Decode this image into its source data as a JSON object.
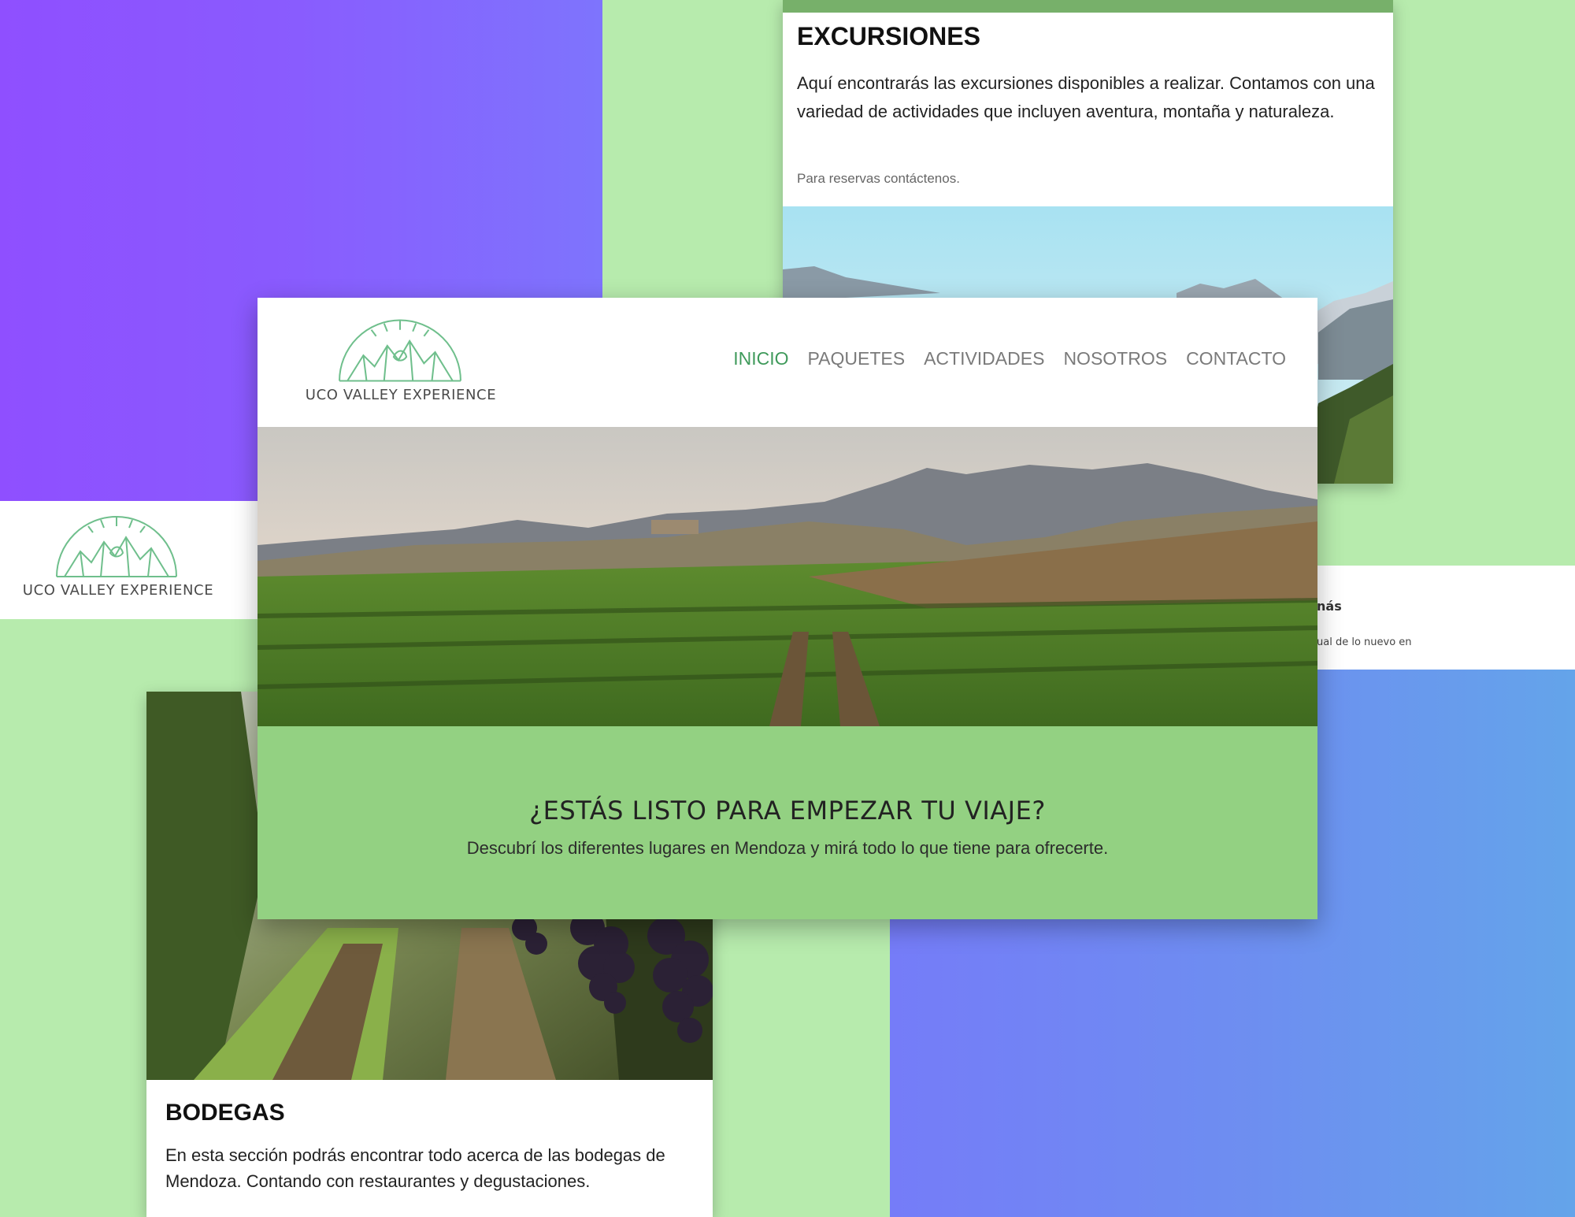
{
  "brand": {
    "name": "UCO VALLEY EXPERIENCE",
    "logo_icon": "mountain-arch-logo-icon",
    "logo_color": "#6fbf8c"
  },
  "side_logo": {
    "name": "UCO VALLEY EXPERIENCE"
  },
  "right_strip": {
    "title_fragment": "nás",
    "text_fragment": "ual de lo nuevo en"
  },
  "excursiones_card": {
    "title": "EXCURSIONES",
    "description": "Aquí encontrarás las excursiones disponibles a realizar. Contamos con una variedad de actividades que incluyen aventura, montaña y naturaleza.",
    "note": "Para reservas contáctenos.",
    "image": "mountain-landscape-photo"
  },
  "bodegas_card": {
    "title": "BODEGAS",
    "description": "En esta sección podrás encontrar todo acerca de las bodegas de Mendoza. Contando con restaurantes y degustaciones.",
    "image": "grape-vineyard-photo"
  },
  "main_site": {
    "nav": [
      {
        "label": "INICIO",
        "active": true
      },
      {
        "label": "PAQUETES",
        "active": false
      },
      {
        "label": "ACTIVIDADES",
        "active": false
      },
      {
        "label": "NOSOTROS",
        "active": false
      },
      {
        "label": "CONTACTO",
        "active": false
      }
    ],
    "hero_image": "vineyard-valley-photo",
    "cta": {
      "title": "¿ESTÁS LISTO PARA EMPEZAR TU VIAJE?",
      "subtitle": "Descubrí los diferentes lugares en Mendoza y mirá todo lo que tiene para ofrecerte."
    }
  },
  "colors": {
    "purple_bg": "#8f4fff",
    "green_bg": "#b7ebad",
    "blue_bg": "#6d8ff0",
    "cta_green": "#93d182",
    "nav_active": "#3f9a5b"
  }
}
